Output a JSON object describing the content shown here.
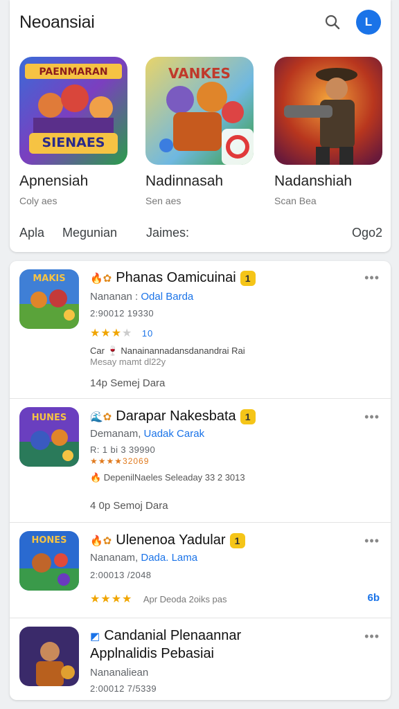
{
  "header": {
    "title": "Neoansiai",
    "avatar_initial": "L"
  },
  "featured": [
    {
      "name": "Apnensiah",
      "sub": "Coly aes",
      "banner": "SIENAES"
    },
    {
      "name": "Nadinnasah",
      "sub": "Sen aes",
      "banner": "VANKES"
    },
    {
      "name": "Nadanshiah",
      "sub": "Scan Bea",
      "banner": ""
    }
  ],
  "tabs": [
    "Apla",
    "Megunian",
    "Jaimes:",
    "Ogo2"
  ],
  "list": [
    {
      "lead": "🔥✿",
      "title": "Phanas Oamicuinai",
      "badge": "1",
      "dev_prefix": "Nananan : ",
      "dev_link": "Odal Barda",
      "meta": "2:90012 19330",
      "stars": "★★★",
      "stars_off": "★",
      "stars_tag": "10",
      "info1": "Car 🍷 Nanainannadansdanandrai Rai",
      "info2": "Mesay mamt dl22y",
      "footer": "14p   Semej Dara",
      "icon_text": "MAKIS"
    },
    {
      "lead": "🌊✿",
      "title": "Darapar Nakesbata",
      "badge": "1",
      "dev_prefix": "Demanam, ",
      "dev_link": "Uadak Carak",
      "meta": "R: 1 bi 3 39990",
      "stars": "★★★★32069",
      "stars_off": "",
      "stars_tag": "",
      "info1": "🔥 DepenilNaeles Seleaday 33 2 3013",
      "info2": "",
      "footer": "4 0p   Semoj Dara",
      "icon_text": "HUNES"
    },
    {
      "lead": "🔥✿",
      "title": "Ulenenoa Yadular",
      "badge": "1",
      "dev_prefix": "Nananam, ",
      "dev_link": "Dada. Lama",
      "meta": "2:00013 /2048",
      "stars": "★★★★",
      "stars_off": "",
      "stars_tag": "Apr Deoda 2oiks pas",
      "info1": "",
      "info2": "",
      "footer": "",
      "extra": "6b",
      "icon_text": "HONES"
    },
    {
      "lead": "◩",
      "title": "Candanial Plenaannar",
      "title2": "Applnalidis Pebasiai",
      "badge": "",
      "dev_prefix": "Nananaliean",
      "dev_link": "",
      "meta": "2:00012 7/5339",
      "stars": "",
      "stars_off": "",
      "stars_tag": "",
      "info1": "",
      "info2": "",
      "footer": "",
      "icon_text": ""
    }
  ],
  "colors": {
    "accent": "#1a73e8",
    "star": "#f0a500",
    "badge": "#f5c518"
  }
}
